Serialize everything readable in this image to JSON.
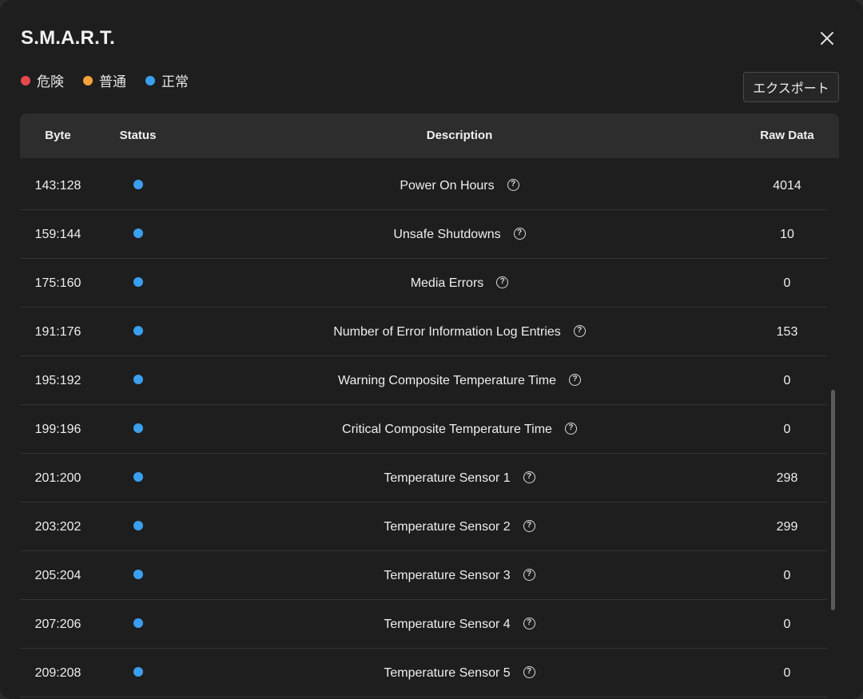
{
  "dialog": {
    "title": "S.M.A.R.T.",
    "export_label": "エクスポート"
  },
  "legend": [
    {
      "label": "危険",
      "color": "#e5484d"
    },
    {
      "label": "普通",
      "color": "#f5a23c"
    },
    {
      "label": "正常",
      "color": "#3b9ff0"
    }
  ],
  "table": {
    "headers": {
      "byte": "Byte",
      "status": "Status",
      "description": "Description",
      "raw": "Raw Data"
    },
    "status_color_normal": "#3b9ff0",
    "help_icon": "question-circle-icon",
    "rows": [
      {
        "byte": "143:128",
        "description": "Power On Hours",
        "raw": "4014"
      },
      {
        "byte": "159:144",
        "description": "Unsafe Shutdowns",
        "raw": "10"
      },
      {
        "byte": "175:160",
        "description": "Media Errors",
        "raw": "0"
      },
      {
        "byte": "191:176",
        "description": "Number of Error Information Log Entries",
        "raw": "153"
      },
      {
        "byte": "195:192",
        "description": "Warning Composite Temperature Time",
        "raw": "0"
      },
      {
        "byte": "199:196",
        "description": "Critical Composite Temperature Time",
        "raw": "0"
      },
      {
        "byte": "201:200",
        "description": "Temperature Sensor 1",
        "raw": "298"
      },
      {
        "byte": "203:202",
        "description": "Temperature Sensor 2",
        "raw": "299"
      },
      {
        "byte": "205:204",
        "description": "Temperature Sensor 3",
        "raw": "0"
      },
      {
        "byte": "207:206",
        "description": "Temperature Sensor 4",
        "raw": "0"
      },
      {
        "byte": "209:208",
        "description": "Temperature Sensor 5",
        "raw": "0"
      }
    ]
  }
}
